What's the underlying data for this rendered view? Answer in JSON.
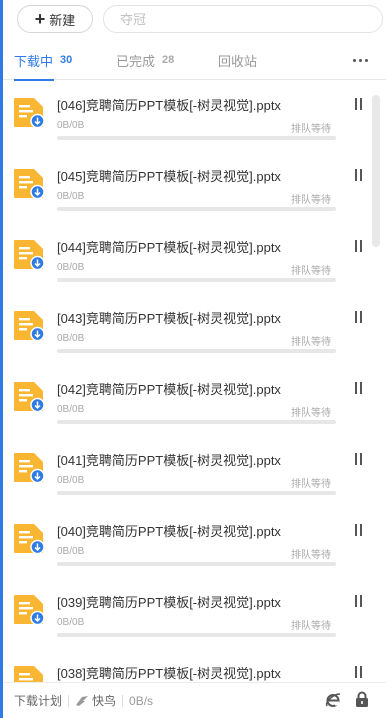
{
  "header": {
    "new_button_label": "新建",
    "search_placeholder": "夺冠"
  },
  "tabs": [
    {
      "label": "下载中",
      "count": "30",
      "active": true
    },
    {
      "label": "已完成",
      "count": "28",
      "active": false
    },
    {
      "label": "回收站",
      "count": "",
      "active": false
    }
  ],
  "downloads": [
    {
      "name": "[046]竞聘简历PPT模板[-树灵视觉].pptx",
      "size": "0B/0B",
      "status": "排队等待",
      "progress": 0
    },
    {
      "name": "[045]竞聘简历PPT模板[-树灵视觉].pptx",
      "size": "0B/0B",
      "status": "排队等待",
      "progress": 0
    },
    {
      "name": "[044]竞聘简历PPT模板[-树灵视觉].pptx",
      "size": "0B/0B",
      "status": "排队等待",
      "progress": 0
    },
    {
      "name": "[043]竞聘简历PPT模板[-树灵视觉].pptx",
      "size": "0B/0B",
      "status": "排队等待",
      "progress": 0
    },
    {
      "name": "[042]竞聘简历PPT模板[-树灵视觉].pptx",
      "size": "0B/0B",
      "status": "排队等待",
      "progress": 0
    },
    {
      "name": "[041]竞聘简历PPT模板[-树灵视觉].pptx",
      "size": "0B/0B",
      "status": "排队等待",
      "progress": 0
    },
    {
      "name": "[040]竞聘简历PPT模板[-树灵视觉].pptx",
      "size": "0B/0B",
      "status": "排队等待",
      "progress": 0
    },
    {
      "name": "[039]竞聘简历PPT模板[-树灵视觉].pptx",
      "size": "0B/0B",
      "status": "排队等待",
      "progress": 0
    },
    {
      "name": "[038]竞聘简历PPT模板[-树灵视觉].pptx",
      "size": "0B/0B",
      "status": "排队等待",
      "progress": 0
    }
  ],
  "footer": {
    "plan_label": "下载计划",
    "fast_label": "快鸟",
    "speed": "0B/s"
  },
  "colors": {
    "accent": "#2f7be5",
    "file_icon": "#f8b632"
  },
  "icons": {
    "new": "plus-icon",
    "more": "more-dots-icon",
    "file": "document-download-icon",
    "pause": "pause-icon",
    "fast": "bird-icon",
    "browser": "ie-browser-icon",
    "lock": "lock-icon"
  }
}
